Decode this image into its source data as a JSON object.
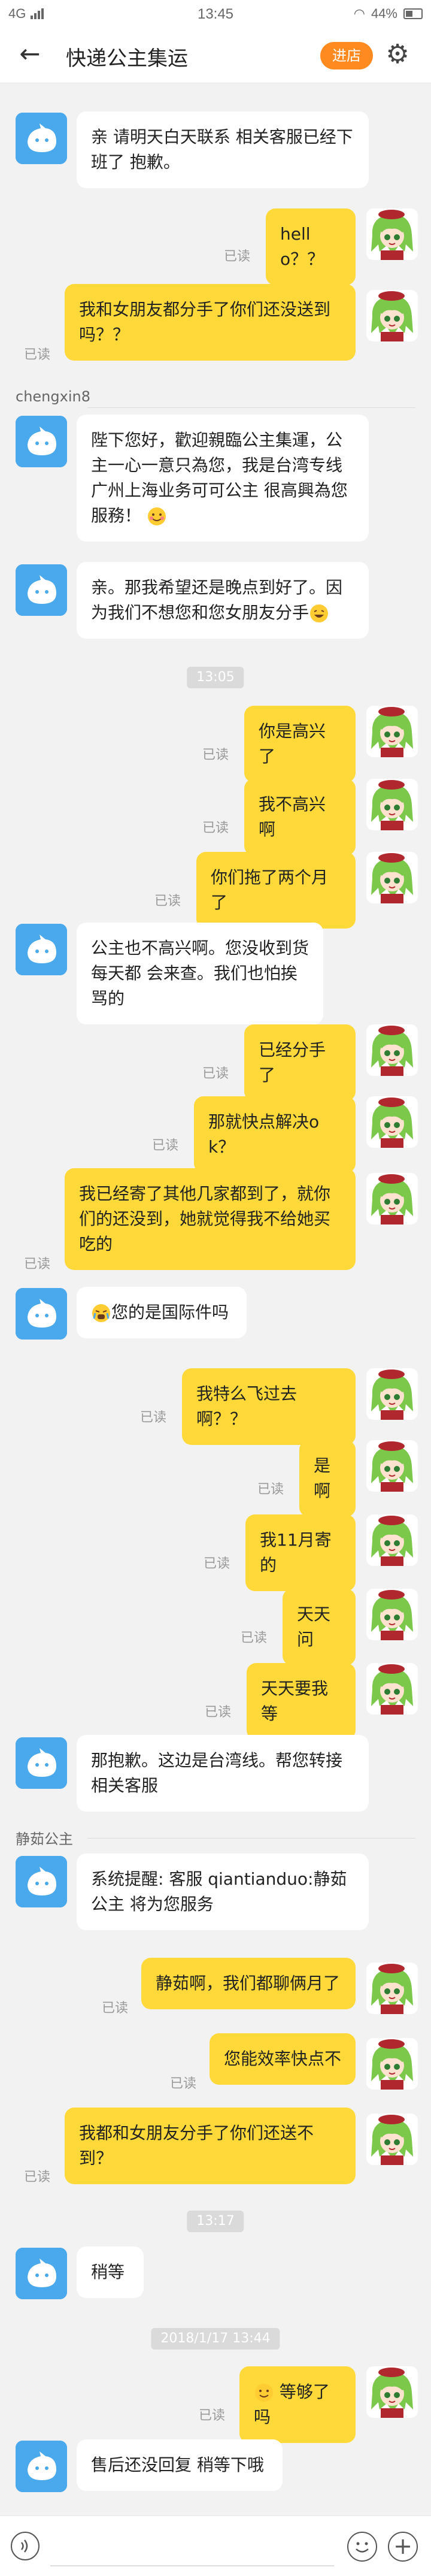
{
  "status_bar": {
    "network": "4G",
    "time": "13:45",
    "battery": "44%"
  },
  "header": {
    "title": "快递公主集运",
    "store_button": "进店"
  },
  "messages": [
    {
      "text": "亲 请明天白天联系 相关客服已经下班了 抱歉。"
    },
    {
      "text": "hello？？",
      "read": "已读"
    },
    {
      "text": "我和女朋友都分手了你们还没送到吗？？",
      "read": "已读"
    },
    {
      "sender": "chengxin8"
    },
    {
      "text": "陛下您好，歡迎親臨公主集運，公主一心一意只為您，我是台湾专线广州上海业务可可公主 很高興為您服務！"
    },
    {
      "text": "亲。那我希望还是晚点到好了。因为我们不想您和您女朋友分手"
    },
    {
      "timestamp": "13:05"
    },
    {
      "text": "你是高兴了",
      "read": "已读"
    },
    {
      "text": "我不高兴啊",
      "read": "已读"
    },
    {
      "text": "你们拖了两个月了",
      "read": "已读"
    },
    {
      "text": "公主也不高兴啊。您没收到货每天都 会来查。我们也怕挨骂的"
    },
    {
      "text": "已经分手了",
      "read": "已读"
    },
    {
      "text": "那就快点解决ok？",
      "read": "已读"
    },
    {
      "text": "我已经寄了其他几家都到了，就你们的还没到，她就觉得我不给她买吃的",
      "read": "已读"
    },
    {
      "text": "您的是国际件吗"
    },
    {
      "text": "我特么飞过去啊？？",
      "read": "已读"
    },
    {
      "text": "是啊",
      "read": "已读"
    },
    {
      "text": "我11月寄的",
      "read": "已读"
    },
    {
      "text": "天天问",
      "read": "已读"
    },
    {
      "text": "天天要我等",
      "read": "已读"
    },
    {
      "text": "那抱歉。这边是台湾线。帮您转接相关客服"
    },
    {
      "sender": "静茹公主"
    },
    {
      "text": "系统提醒: 客服 qiantianduo:静茹公主 将为您服务"
    },
    {
      "text": "静茹啊，我们都聊俩月了",
      "read": "已读"
    },
    {
      "text": "您能效率快点不",
      "read": "已读"
    },
    {
      "text": "我都和女朋友分手了你们还送不到？",
      "read": "已读"
    },
    {
      "timestamp": "13:17"
    },
    {
      "text": "稍等"
    },
    {
      "timestamp": "2018/1/17 13:44"
    },
    {
      "text": "等够了吗",
      "read": "已读"
    },
    {
      "text": "售后还没回复 稍等下哦"
    }
  ],
  "input": {
    "placeholder": ""
  },
  "icons": {
    "back": "back-arrow-icon",
    "settings": "gear-icon",
    "voice": "voice-icon",
    "emoji": "emoji-icon",
    "plus": "plus-icon"
  },
  "colors": {
    "user_bubble": "#ffd93a",
    "bot_avatar": "#4aa8ec",
    "store_button": "#ff8a1f"
  }
}
